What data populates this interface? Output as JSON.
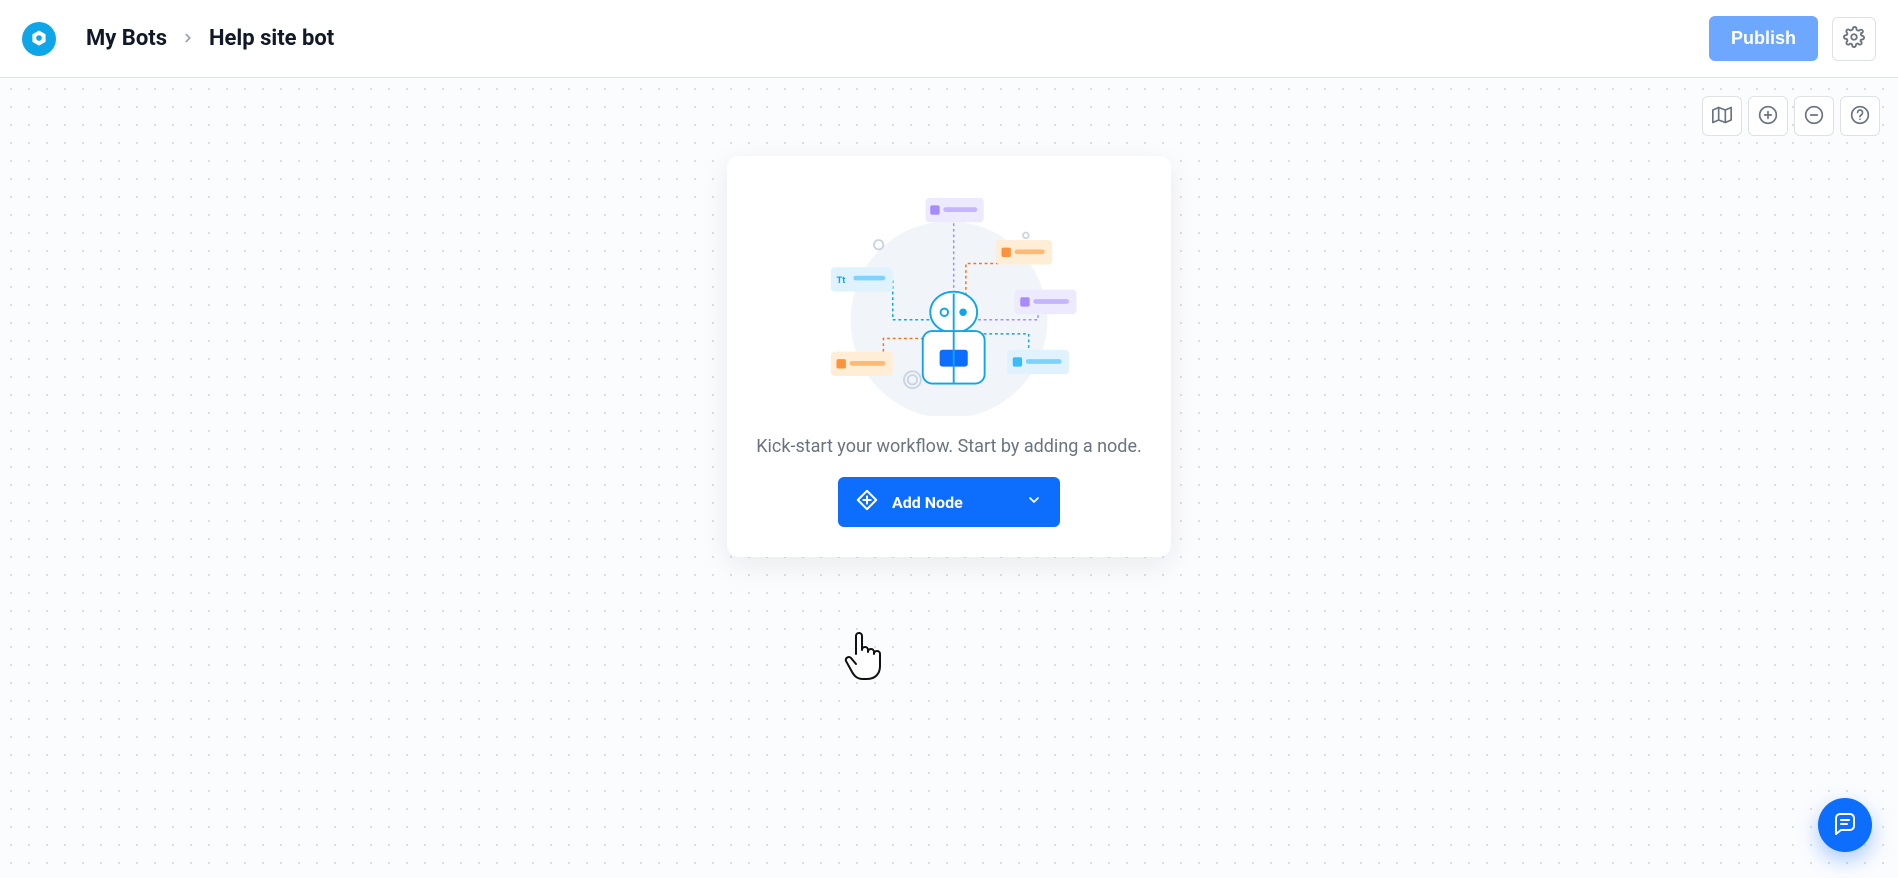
{
  "header": {
    "breadcrumb": {
      "root": "My Bots",
      "current": "Help site bot"
    },
    "publish_label": "Publish"
  },
  "canvas_tools": {
    "map": "minimap",
    "zoom_in": "zoom-in",
    "zoom_out": "zoom-out",
    "help": "help"
  },
  "empty_state": {
    "message": "Kick-start your workflow. Start by adding a node.",
    "add_node_label": "Add Node"
  },
  "fab": {
    "name": "chat"
  }
}
